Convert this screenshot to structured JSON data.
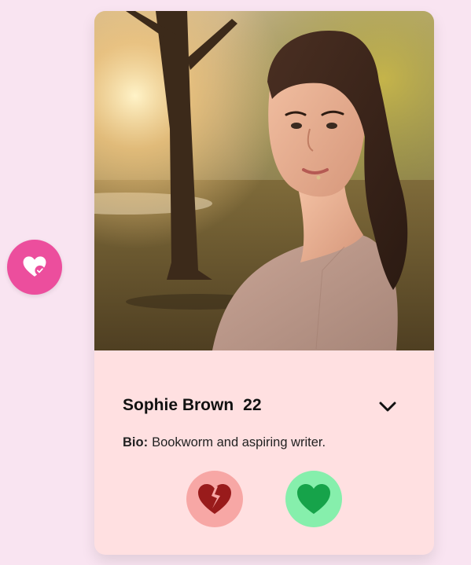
{
  "profile": {
    "name": "Sophie Brown",
    "age": "22",
    "bio_label": "Bio:",
    "bio": "Bookworm and aspiring writer.",
    "photo": "portrait-photo"
  },
  "icons": {
    "fab": "heart-check-icon",
    "expand": "chevron-down-icon",
    "pass": "broken-heart-icon",
    "like": "heart-icon"
  },
  "colors": {
    "page_bg": "#f9e4f1",
    "card_bg": "#ffe0e1",
    "fab": "#ec4e9d",
    "pass_bg": "#f7a7a5",
    "pass_icon": "#991b1b",
    "like_bg": "#86efac",
    "like_icon": "#16a34a"
  }
}
